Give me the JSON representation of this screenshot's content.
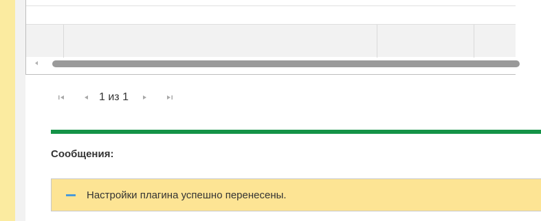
{
  "pager": {
    "text": "1 из 1",
    "first_icon": "first-page-icon",
    "prev_icon": "prev-page-icon",
    "next_icon": "next-page-icon",
    "last_icon": "last-page-icon"
  },
  "messages": {
    "title": "Сообщения:",
    "items": [
      {
        "text": "Настройки плагина успешно перенесены."
      }
    ]
  },
  "colors": {
    "left_strip": "#fbeba0",
    "green_line": "#149347",
    "message_bg": "#fde494",
    "message_dash": "#4a9ad9"
  }
}
